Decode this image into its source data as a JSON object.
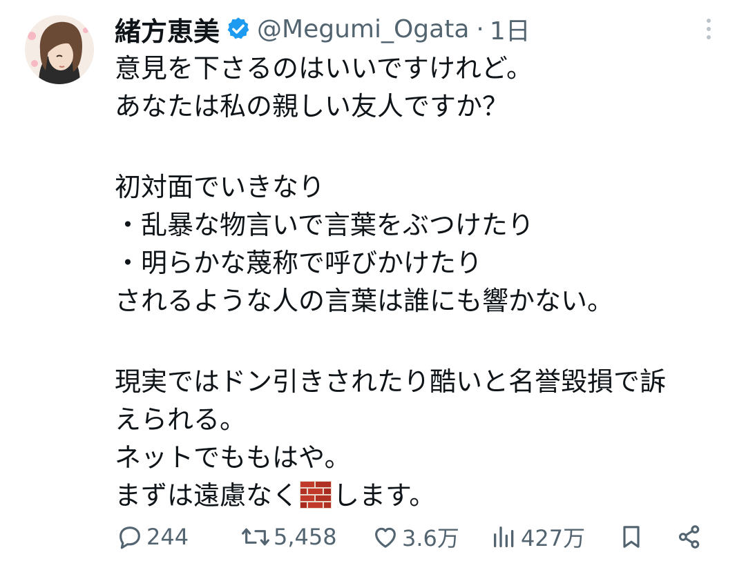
{
  "tweet": {
    "author": {
      "display_name": "緒方恵美",
      "handle": "@Megumi_Ogata",
      "verified_icon": "verified-badge-icon",
      "accent_color": "#1d9bf0"
    },
    "separator": "·",
    "timestamp": "1日",
    "text_lines": [
      "意見を下さるのはいいですけれど。",
      "あなたは私の親しい友人ですか？",
      "",
      "初対面でいきなり",
      "・乱暴な物言いで言葉をぶつけたり",
      "・明らかな蔑称で呼びかけたり",
      "されるような人の言葉は誰にも響かない。",
      "",
      "現実ではドン引きされたり酷いと名誉毀損で訴",
      "えられる。",
      "ネットでももはや。"
    ],
    "last_line": {
      "before": "まずは遠慮なく",
      "emoji_icon": "brick-emoji-icon",
      "after": "します。"
    },
    "actions": {
      "reply": {
        "icon": "reply-icon",
        "count": "244"
      },
      "retweet": {
        "icon": "retweet-icon",
        "count": "5,458"
      },
      "like": {
        "icon": "heart-icon",
        "count": "3.6万"
      },
      "views": {
        "icon": "views-chart-icon",
        "count": "427万"
      },
      "bookmark": {
        "icon": "bookmark-icon"
      },
      "share": {
        "icon": "share-icon"
      }
    },
    "colors": {
      "text": "#0f1419",
      "secondary": "#536471",
      "brick": "#c0392b"
    }
  }
}
